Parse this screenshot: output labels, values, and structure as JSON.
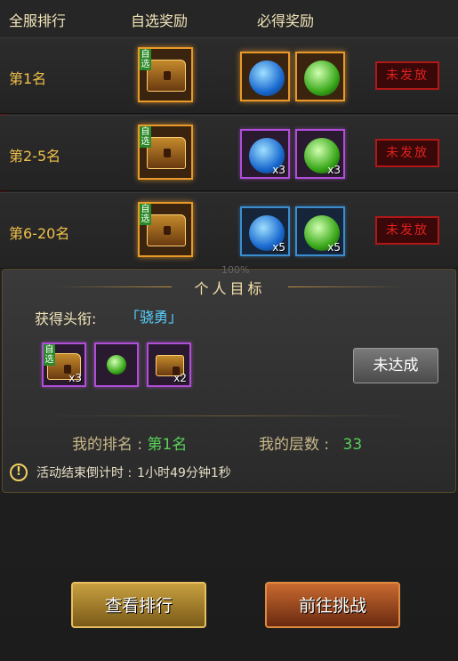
{
  "header": {
    "col_rank": "全服排行",
    "col_optional": "自选奖励",
    "col_guaranteed": "必得奖励"
  },
  "rows": [
    {
      "rank": "第1名",
      "tag": "自选",
      "status": "未发放",
      "items": [
        {
          "icon": "blue-orb-icon",
          "qty": ""
        },
        {
          "icon": "green-orb-icon",
          "qty": ""
        }
      ]
    },
    {
      "rank": "第2-5名",
      "tag": "自选",
      "status": "未发放",
      "items": [
        {
          "icon": "blue-orb-icon",
          "qty": "x3"
        },
        {
          "icon": "green-orb-icon",
          "qty": "x3"
        }
      ]
    },
    {
      "rank": "第6-20名",
      "tag": "自选",
      "status": "未发放",
      "items": [
        {
          "icon": "blue-orb-icon",
          "qty": "x5"
        },
        {
          "icon": "green-orb-icon",
          "qty": "x5"
        }
      ]
    }
  ],
  "panel": {
    "percent": "100%",
    "title": "个人目标",
    "title_label": "获得头衔:",
    "title_value": "「骁勇」",
    "rewards": [
      {
        "icon": "chest-icon",
        "tag": "自选",
        "qty": "x3"
      },
      {
        "icon": "green-orb-icon",
        "tag": "",
        "qty": ""
      },
      {
        "icon": "gold-ore-icon",
        "tag": "",
        "qty": "x2"
      }
    ],
    "unmet_button": "未达成",
    "my_rank_label": "我的排名 :",
    "my_rank_value": "第1名",
    "my_floor_label": "我的层数 :",
    "my_floor_value": "33",
    "countdown_label": "活动结束倒计时 :",
    "countdown_value": "1小时49分钟1秒"
  },
  "buttons": {
    "view_ranking": "查看排行",
    "go_challenge": "前往挑战"
  },
  "colors": {
    "gold_text": "#f0c04a",
    "green_value": "#58d058",
    "blue_title": "#58d0ff",
    "stamp_red": "#e02020"
  }
}
